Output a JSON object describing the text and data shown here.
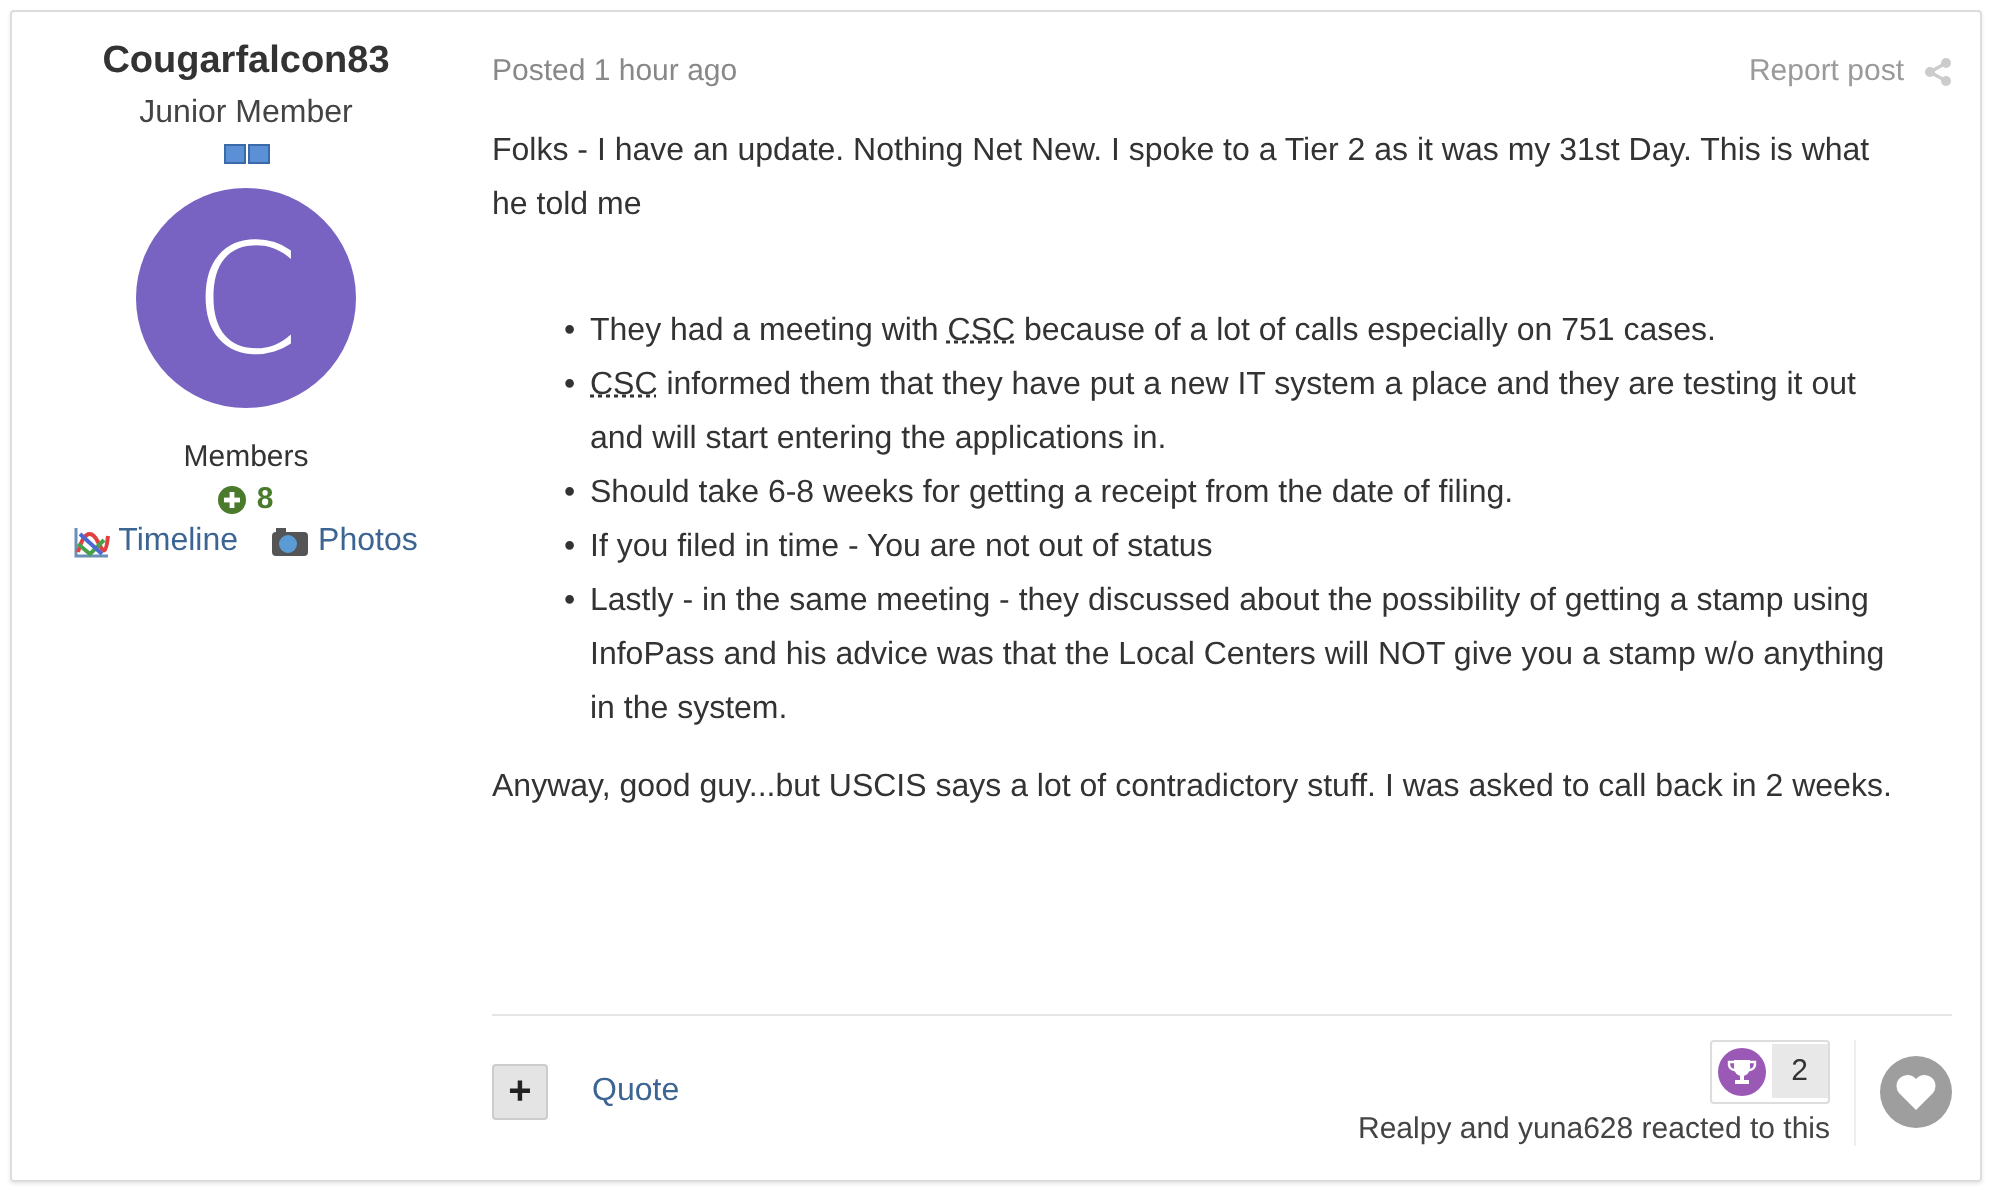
{
  "author": {
    "name": "Cougarfalcon83",
    "rank": "Junior Member",
    "avatar_letter": "C",
    "group": "Members",
    "reputation": "8",
    "links": [
      {
        "label": "Timeline",
        "kind": "timeline"
      },
      {
        "label": "Photos",
        "kind": "photos"
      }
    ]
  },
  "post": {
    "posted": "Posted",
    "time": "1 hour ago",
    "report": "Report post",
    "intro": "Folks - I have an update. Nothing Net New. I spoke to a Tier 2 as it was my 31st Day. This is what he told me",
    "bullets": [
      {
        "marker": "•",
        "segments": [
          {
            "text": "They had a meeting with "
          },
          {
            "text": "CSC",
            "kind": "abbr"
          },
          {
            "text": " because of a lot of calls especially on 751 cases."
          }
        ]
      },
      {
        "marker": "•",
        "segments": [
          {
            "text": "CSC",
            "kind": "abbr"
          },
          {
            "text": " informed them that they have put a new IT system a place and they are testing it out and will start entering the applications in."
          }
        ]
      },
      {
        "marker": "•",
        "segments": [
          {
            "text": "Should take 6-8 weeks for getting a receipt from the date of filing."
          }
        ]
      },
      {
        "marker": "•",
        "segments": [
          {
            "text": "If you filed in time - You are not out of status"
          }
        ]
      },
      {
        "marker": "•",
        "segments": [
          {
            "text": "Lastly - in the same meeting - they discussed about the possibility of getting a stamp using InfoPass and his advice was that the Local Centers will NOT give you a stamp w/o anything in the system."
          }
        ]
      }
    ],
    "outro": "Anyway, good guy...but USCIS says a lot of contradictory stuff. I was asked to call back in 2 weeks."
  },
  "footer": {
    "multiquote": "+",
    "quote": "Quote",
    "reaction_count": "2",
    "reacted": "Realpy and yuna628 reacted to this"
  }
}
